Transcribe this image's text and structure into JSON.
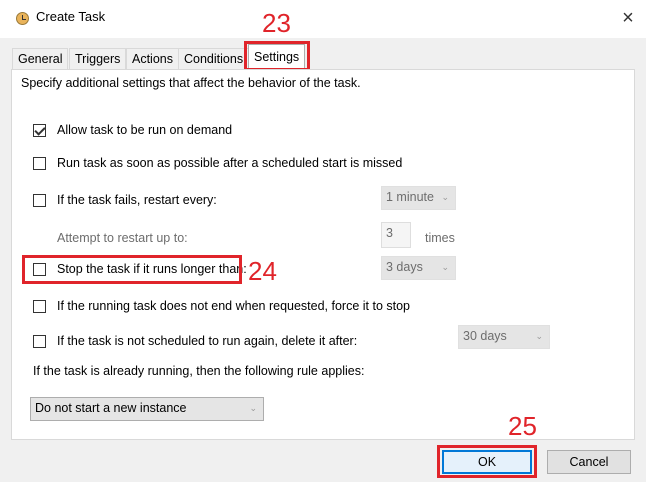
{
  "window": {
    "title": "Create Task",
    "close_glyph": "×"
  },
  "tabs": [
    {
      "label": "General"
    },
    {
      "label": "Triggers"
    },
    {
      "label": "Actions"
    },
    {
      "label": "Conditions"
    },
    {
      "label": "Settings",
      "active": true
    }
  ],
  "settings": {
    "description": "Specify additional settings that affect the behavior of the task.",
    "allow_on_demand": {
      "label": "Allow task to be run on demand",
      "checked": true
    },
    "run_asap": {
      "label": "Run task as soon as possible after a scheduled start is missed",
      "checked": false
    },
    "restart_if_fails": {
      "label": "If the task fails, restart every:",
      "checked": false,
      "value": "1 minute"
    },
    "restart_attempts": {
      "label": "Attempt to restart up to:",
      "value": "3",
      "unit": "times"
    },
    "stop_if_longer": {
      "label": "Stop the task if it runs longer than:",
      "checked": false,
      "value": "3 days"
    },
    "force_stop": {
      "label": "If the running task does not end when requested, force it to stop",
      "checked": false
    },
    "delete_if_not_scheduled": {
      "label": "If the task is not scheduled to run again, delete it after:",
      "checked": false,
      "value": "30 days"
    },
    "rule_label": "If the task is already running, then the following rule applies:",
    "rule_value": "Do not start a new instance"
  },
  "buttons": {
    "ok": "OK",
    "cancel": "Cancel"
  },
  "annotations": {
    "settings_tab_number": "23",
    "stop_task_number": "24",
    "ok_button_number": "25",
    "highlight_color": "#e0242a"
  },
  "icons": {
    "title_icon": "task-scheduler-clock-icon",
    "dropdown_arrow": "chevron-down-icon"
  }
}
